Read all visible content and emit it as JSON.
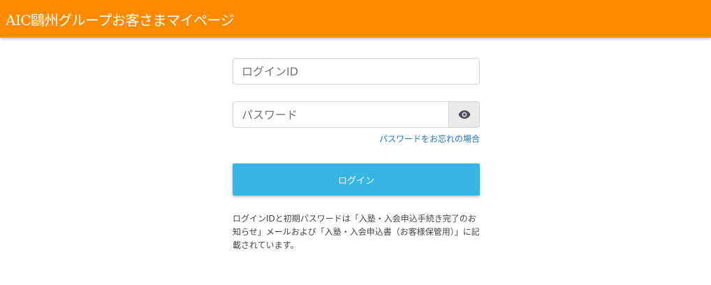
{
  "header": {
    "title": "AIC鷗州グループお客さまマイページ"
  },
  "login_form": {
    "login_id_placeholder": "ログインID",
    "password_placeholder": "パスワード",
    "show_password_icon": "eye-icon",
    "forgot_password_link": "パスワードをお忘れの場合",
    "login_button": "ログイン",
    "notice": "ログインIDと初期パスワードは「入塾・入会申込手続き完了のお知らせ」メールおよび「入塾・入会申込書（お客様保管用）」に記載されています。"
  },
  "colors": {
    "header_bg": "#ff8a00",
    "button_bg": "#37b6e6",
    "link": "#1a73c9"
  }
}
